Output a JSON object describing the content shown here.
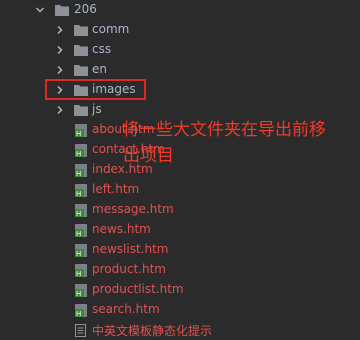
{
  "tree": {
    "root": {
      "label": "206",
      "expanded": true
    },
    "folders": [
      {
        "label": "comm",
        "expanded": false
      },
      {
        "label": "css",
        "expanded": false
      },
      {
        "label": "en",
        "expanded": false
      },
      {
        "label": "images",
        "expanded": false
      },
      {
        "label": "js",
        "expanded": false
      }
    ],
    "files": [
      {
        "label": "about.htm",
        "kind": "html"
      },
      {
        "label": "contact.htm",
        "kind": "html"
      },
      {
        "label": "index.htm",
        "kind": "html"
      },
      {
        "label": "left.htm",
        "kind": "html"
      },
      {
        "label": "message.htm",
        "kind": "html"
      },
      {
        "label": "news.htm",
        "kind": "html"
      },
      {
        "label": "newslist.htm",
        "kind": "html"
      },
      {
        "label": "product.htm",
        "kind": "html"
      },
      {
        "label": "productlist.htm",
        "kind": "html"
      },
      {
        "label": "search.htm",
        "kind": "html"
      },
      {
        "label": "中英文模板静态化提示",
        "kind": "text"
      }
    ]
  },
  "annotation": {
    "line1": "将一些大文件夹在导出前移",
    "line2": "出项目"
  },
  "colors": {
    "background": "#2b2b2b",
    "text": "#a9b7c6",
    "modified_text": "#e05252",
    "folder": "#8c9298",
    "annotation": "#f03a2a",
    "highlight_border": "#e02626"
  }
}
